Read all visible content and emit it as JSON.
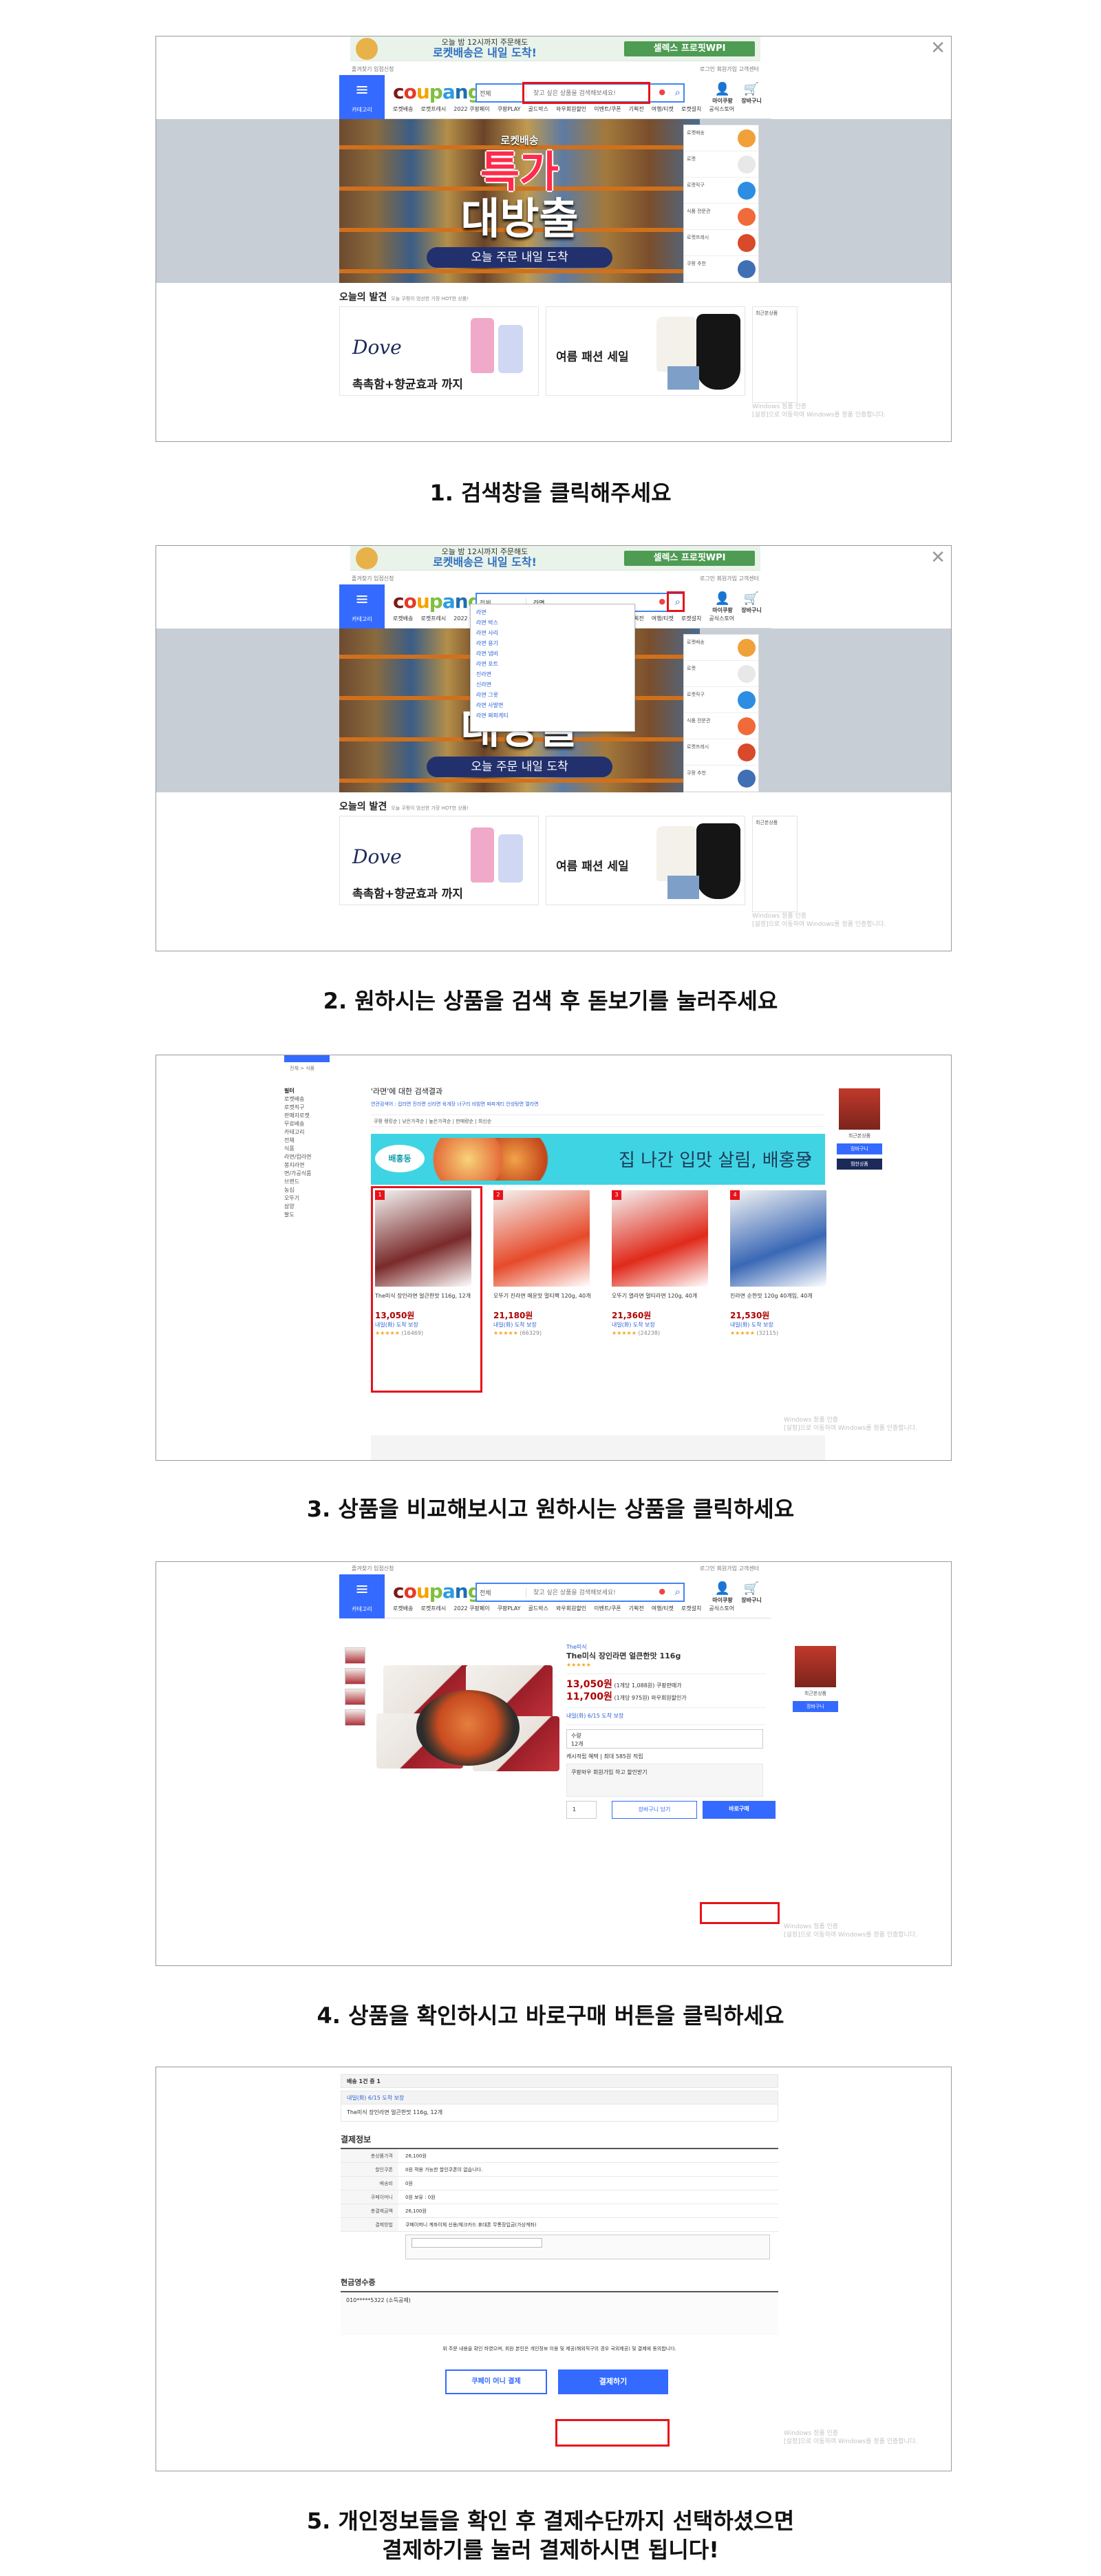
{
  "site": {
    "top_banner_line1": "오늘 밤 12시까지 주문해도",
    "top_banner_line2": "로켓배송은 내일 도착!",
    "top_banner_right": "셀렉스 프로핏WPI",
    "util_left": "즐겨찾기   입점신청",
    "util_right": "로그인  회원가입  고객센터",
    "category_label": "카테고리",
    "logo": "coupang",
    "logo_colors": [
      "#7b1a1a",
      "#e53a28",
      "#f4a300",
      "#7fbf3f",
      "#2e9be3",
      "#1f6fb2",
      "#7fbf3f"
    ],
    "search_category": "전체",
    "search_placeholder": "찾고 싶은 상품을 검색해보세요!",
    "my_coupang": "마이쿠팡",
    "cart": "장바구니",
    "nav_items": [
      "로켓배송",
      "로켓프레시",
      "2022 쿠팡페이",
      "쿠팡PLAY",
      "골드박스",
      "와우회원할인",
      "이벤트/쿠폰",
      "기획전",
      "여행/티켓",
      "로켓설치",
      "공식스토어"
    ],
    "hero_badge": "로켓배송",
    "hero_line1": "특가",
    "hero_line2": "대방출",
    "hero_line3": "오늘 주문 내일 도착",
    "side_panel": [
      "로켓배송",
      "로켓",
      "로켓직구",
      "식품 전문관",
      "로켓프레시",
      "쿠팡 추천"
    ],
    "today_title": "오늘의 발견",
    "today_sub": "오늘 쿠팡이 엄선한 가장 HOT한 상품!",
    "card_a_brand": "Dove",
    "card_a_caption": "촉촉함+향균효과 까지",
    "card_b_caption": "여름 패션 세일",
    "small_col": "최근본상품",
    "windows_line1": "Windows 정품 인증",
    "windows_line2": "[설정]으로 이동하여 Windows를 정품 인증합니다."
  },
  "close_icon": "close-icon",
  "accent": "#346aff",
  "highlight": "#e8121a",
  "step1": "1. 검색창을 클릭해주세요",
  "step2": "2. 원하시는 상품을 검색 후 돋보기를 눌러주세요",
  "step3": "3. 상품을 비교해보시고 원하시는 상품을 클릭하세요",
  "step4": "4. 상품을 확인하시고 바로구매 버튼을 클릭하세요",
  "step5_line1": "5. 개인정보들을 확인 후 결제수단까지 선택하셨으면",
  "step5_line2": "결제하기를 눌러 결제하시면 됩니다!",
  "shot2": {
    "search_value": "라면",
    "suggestions": [
      "라면",
      "라면 박스",
      "라면 사리",
      "라면 용기",
      "라면 냄비",
      "라면 포트",
      "진라면",
      "신라면",
      "라면 그릇",
      "라면 사발면",
      "라면 짜파게티"
    ]
  },
  "shot3": {
    "breadcrumb": "전체 > 식품",
    "side_title": "필터",
    "side_items": [
      "로켓배송",
      "로켓직구",
      "판매자로켓",
      "무료배송",
      "카테고리",
      "전체",
      "식품",
      "라면/컵라면",
      "봉지라면",
      "면/가공식품",
      "브랜드",
      "농심",
      "오뚜기",
      "삼양",
      "팔도"
    ],
    "head": "'라면'에 대한 검색결과",
    "related": "연관검색어 : 컵라면  진라면  신라면  육개장  너구리  비빔면  짜파게티  안성탕면  열라면",
    "tools": "쿠팡 랭킹순 | 낮은가격순 | 높은가격순 | 판매량순 | 최신순",
    "banner_brand": "배홍동",
    "banner_text": "집 나간 입맛 살림, 배홍동",
    "products": [
      {
        "name": "The미식 장인라면 얼큰한맛 116g, 12개",
        "price": "13,050원",
        "delivery": "내일(화) 도착 보장",
        "reviews": "(16469)"
      },
      {
        "name": "오뚜기 진라면 매운맛 멀티팩 120g, 40개",
        "price": "21,180원",
        "delivery": "내일(화) 도착 보장",
        "reviews": "(66329)"
      },
      {
        "name": "오뚜기 열라면 멀티라면 120g, 40개",
        "price": "21,360원",
        "delivery": "내일(화) 도착 보장",
        "reviews": "(24238)"
      },
      {
        "name": "진라면 순한맛 120g 40개입, 40개",
        "price": "21,530원",
        "delivery": "내일(화) 도착 보장",
        "reviews": "(32115)"
      }
    ],
    "right_label": "최근본상품",
    "right_btn1": "장바구니",
    "right_btn2": "찜한상품"
  },
  "shot4": {
    "brand": "The미식",
    "title": "The미식 장인라면 얼큰한맛 116g",
    "price1": "13,050원",
    "price2": "11,700원",
    "price1_note": "(1개당 1,088원) 쿠팡판매가",
    "price2_note": "(1개당 975원) 와우회원할인가",
    "delivery": "내일(화) 6/15 도착 보장",
    "option_label": "수량",
    "option_value": "12개",
    "cash": "캐시적립 혜택 | 최대 585원 적립",
    "membership": "쿠팡와우 회원가입 하고 할인받기",
    "qty": "1",
    "cart_btn": "장바구니 담기",
    "buy_btn": "바로구매"
  },
  "shot5": {
    "delivery_title": "배송 1건 중 1",
    "delivery_date": "내일(화) 6/15 도착 보장",
    "item": "The미식 장인라면 얼큰한맛 116g, 12개",
    "pay_title": "결제정보",
    "rows": [
      {
        "k": "총상품가격",
        "v": "26,100원"
      },
      {
        "k": "할인쿠폰",
        "v": "0원  적용 가능한 할인쿠폰이 없습니다."
      },
      {
        "k": "배송비",
        "v": "0원"
      },
      {
        "k": "쿠페이머니",
        "v": "0원  보유 : 0원"
      },
      {
        "k": "총결제금액",
        "v": "26,100원"
      },
      {
        "k": "결제방법",
        "v": "쿠페이머니  계좌이체  신용/체크카드  휴대폰  무통장입금(가상계좌)"
      }
    ],
    "receipt_title": "현금영수증",
    "receipt_value": "010*****5322 (소득공제)",
    "agree_text": "위 주문 내용을 확인 하였으며, 회원 본인은 개인정보 이용 및 제공(해외직구의 경우 국외제공) 및 결제에 동의합니다.",
    "rocket_btn": "쿠페이 머니 결제",
    "pay_btn": "결제하기"
  }
}
